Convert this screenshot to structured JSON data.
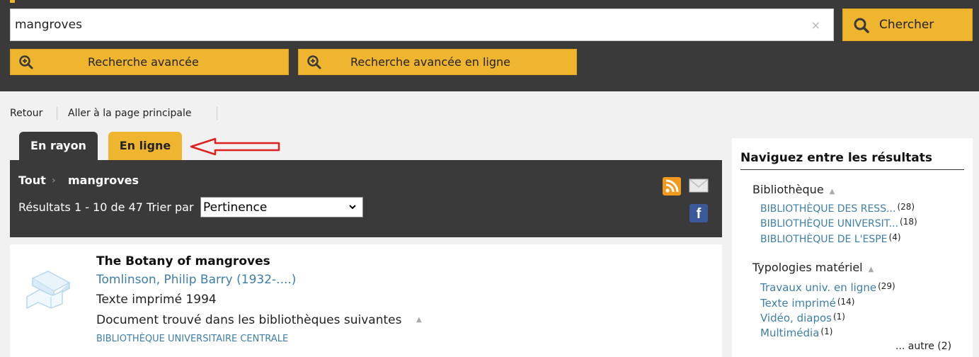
{
  "search": {
    "value": "mangroves",
    "clear_icon": "×",
    "submit_label": "Chercher"
  },
  "advanced": {
    "label": "Recherche avancée",
    "online_label": "Recherche avancée en ligne"
  },
  "breadcrumb": {
    "back": "Retour",
    "home": "Aller à la page principale"
  },
  "tabs": [
    {
      "label": "En rayon",
      "active": true
    },
    {
      "label": "En ligne",
      "active": false
    }
  ],
  "results_header": {
    "root": "Tout",
    "term": "mangroves",
    "count_text": "Résultats 1 - 10 de 47 Trier par",
    "sort_value": "Pertinence",
    "facebook_glyph": "f"
  },
  "result": {
    "title": "The Botany of mangroves",
    "author": "Tomlinson, Philip Barry (1932-....)",
    "type_year": "Texte imprimé 1994",
    "found_in": "Document trouvé dans les bibliothèques suivantes",
    "library": "BIBLIOTHÈQUE UNIVERSITAIRE CENTRALE"
  },
  "sidebar": {
    "title": "Naviguez entre les résultats",
    "facets": [
      {
        "name": "Bibliothèque",
        "items": [
          {
            "label": "BIBLIOTHÈQUE DES RESS...",
            "count": "(28)"
          },
          {
            "label": "BIBLIOTHÈQUE UNIVERSIT...",
            "count": "(18)"
          },
          {
            "label": "BIBLIOTHÈQUE DE L'ESPE",
            "count": "(4)"
          }
        ]
      },
      {
        "name": "Typologies matériel",
        "items": [
          {
            "label": "Travaux univ. en ligne",
            "count": "(29)"
          },
          {
            "label": "Texte imprimé",
            "count": "(14)"
          },
          {
            "label": "Vidéo, diapos",
            "count": "(1)"
          },
          {
            "label": "Multimédia",
            "count": "(1)"
          }
        ]
      }
    ],
    "more": "... autre (2)"
  },
  "colors": {
    "dark": "#3a3a3a",
    "accent": "#f0b52e",
    "link": "#3d7fa6",
    "annotation_arrow": "#e02020"
  }
}
